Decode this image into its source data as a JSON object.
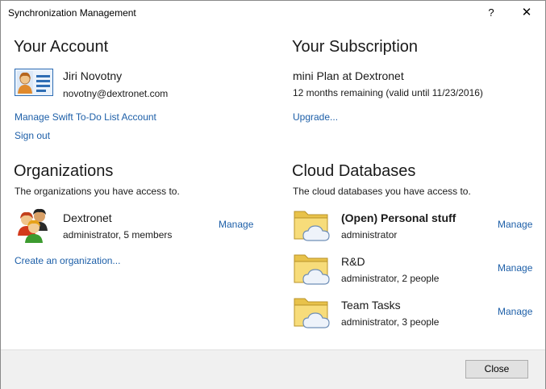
{
  "window": {
    "title": "Synchronization Management",
    "help": "?",
    "close": "✕"
  },
  "account": {
    "heading": "Your Account",
    "name": "Jiri Novotny",
    "email": "novotny@dextronet.com",
    "manage_link": "Manage Swift To-Do List Account",
    "signout_link": "Sign out"
  },
  "subscription": {
    "heading": "Your Subscription",
    "plan": "mini Plan at Dextronet",
    "remaining": "12 months remaining (valid until 11/23/2016)",
    "upgrade_link": "Upgrade..."
  },
  "organizations": {
    "heading": "Organizations",
    "subtitle": "The organizations you have access to.",
    "items": [
      {
        "name": "Dextronet",
        "detail": "administrator, 5 members",
        "action": "Manage"
      }
    ],
    "create_link": "Create an organization..."
  },
  "databases": {
    "heading": "Cloud Databases",
    "subtitle": "The cloud databases you have access to.",
    "items": [
      {
        "name": "(Open) Personal stuff",
        "detail": "administrator",
        "action": "Manage"
      },
      {
        "name": "R&D",
        "detail": "administrator, 2 people",
        "action": "Manage"
      },
      {
        "name": "Team Tasks",
        "detail": "administrator, 3 people",
        "action": "Manage"
      }
    ]
  },
  "footer": {
    "close_label": "Close"
  },
  "colors": {
    "link": "#1d5fa8",
    "footer_bg": "#f0f0f0",
    "folder": "#f5d76e"
  }
}
